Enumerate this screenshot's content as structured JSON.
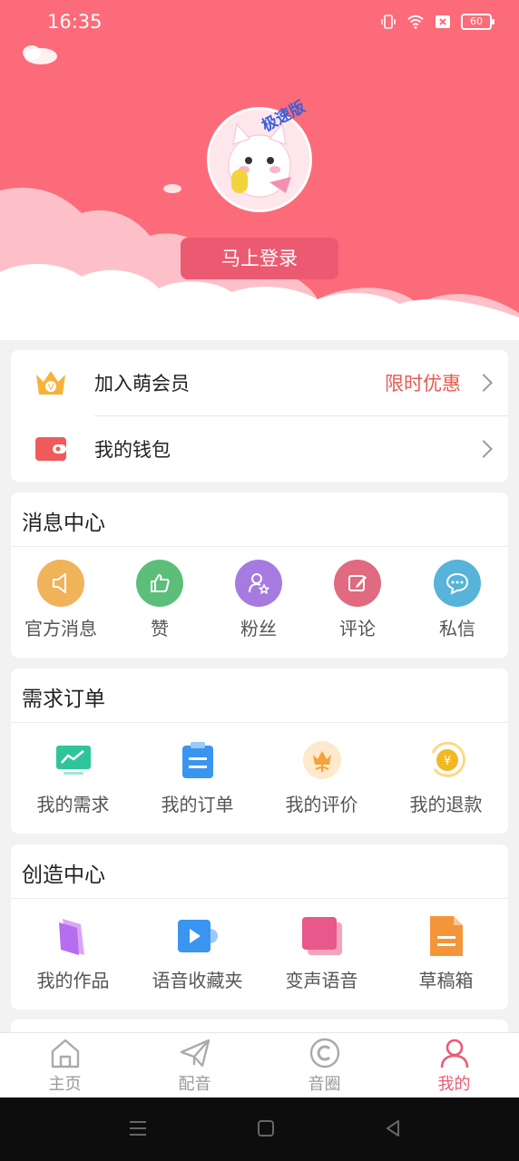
{
  "status": {
    "time": "16:35",
    "battery": "60"
  },
  "header": {
    "avatar_badge": "极速版",
    "login_label": "马上登录"
  },
  "account": {
    "vip": {
      "icon": "crown-icon",
      "label": "加入萌会员",
      "extra": "限时优惠"
    },
    "wallet": {
      "icon": "wallet-icon",
      "label": "我的钱包"
    }
  },
  "messages": {
    "title": "消息中心",
    "items": [
      {
        "label": "官方消息",
        "icon": "megaphone-icon",
        "color": "#f0b35a"
      },
      {
        "label": "赞",
        "icon": "thumbs-up-icon",
        "color": "#5bbf7a"
      },
      {
        "label": "粉丝",
        "icon": "fans-icon",
        "color": "#a57be0"
      },
      {
        "label": "评论",
        "icon": "edit-icon",
        "color": "#e06a80"
      },
      {
        "label": "私信",
        "icon": "chat-icon",
        "color": "#57b3d9"
      }
    ]
  },
  "orders": {
    "title": "需求订单",
    "items": [
      {
        "label": "我的需求",
        "icon": "chart-monitor-icon",
        "color": "#2fc59a"
      },
      {
        "label": "我的订单",
        "icon": "clipboard-icon",
        "color": "#3a95f0"
      },
      {
        "label": "我的评价",
        "icon": "flower-icon",
        "color": "#f2a43a"
      },
      {
        "label": "我的退款",
        "icon": "refund-coin-icon",
        "color": "#f2b824"
      }
    ]
  },
  "create": {
    "title": "创造中心",
    "items": [
      {
        "label": "我的作品",
        "icon": "works-icon",
        "color": "#b56ef0"
      },
      {
        "label": "语音收藏夹",
        "icon": "play-folder-icon",
        "color": "#3a95f0"
      },
      {
        "label": "变声语音",
        "icon": "voice-card-icon",
        "color": "#e8588a"
      },
      {
        "label": "草稿箱",
        "icon": "draft-icon",
        "color": "#f5953a"
      }
    ]
  },
  "nav": {
    "items": [
      {
        "label": "主页",
        "icon": "home-icon"
      },
      {
        "label": "配音",
        "icon": "send-icon"
      },
      {
        "label": "音圈",
        "icon": "circle-c-icon"
      },
      {
        "label": "我的",
        "icon": "profile-icon"
      }
    ],
    "active_color": "#ec5a72"
  },
  "colors": {
    "header_bg": "#fb6b79",
    "login_bg": "#ec5a72",
    "promo": "#e85a4f"
  }
}
